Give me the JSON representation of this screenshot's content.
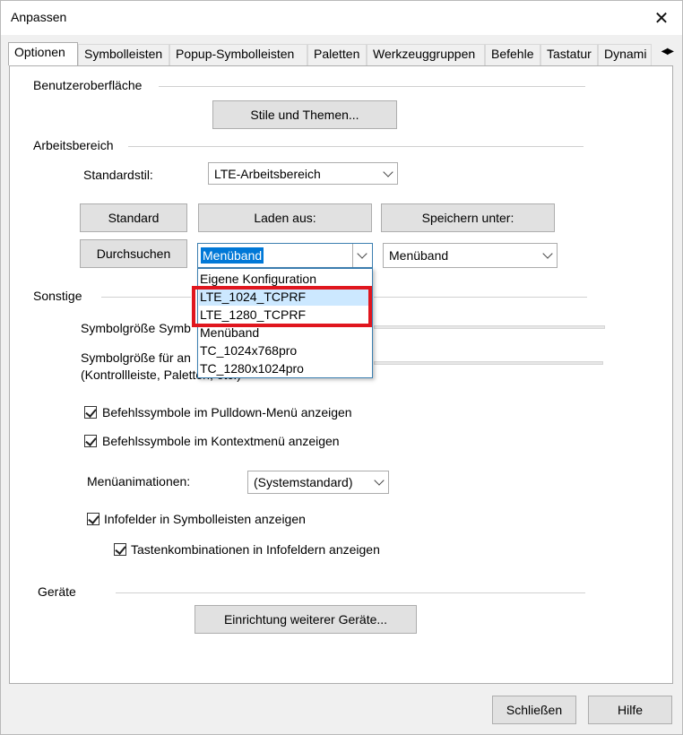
{
  "window": {
    "title": "Anpassen"
  },
  "tabs": [
    {
      "label": "Optionen"
    },
    {
      "label": "Symbolleisten"
    },
    {
      "label": "Popup-Symbolleisten"
    },
    {
      "label": "Paletten"
    },
    {
      "label": "Werkzeuggruppen"
    },
    {
      "label": "Befehle"
    },
    {
      "label": "Tastatur"
    },
    {
      "label": "Dynami"
    }
  ],
  "sections": {
    "ui": "Benutzeroberfläche",
    "workspace": "Arbeitsbereich",
    "misc": "Sonstige",
    "devices": "Geräte"
  },
  "buttons": {
    "styles": "Stile und Themen...",
    "standard": "Standard",
    "load_from": "Laden aus:",
    "save_as": "Speichern unter:",
    "browse": "Durchsuchen",
    "devices_setup": "Einrichtung weiterer Geräte...",
    "close": "Schließen",
    "help": "Hilfe"
  },
  "workspace": {
    "default_style_label": "Standardstil:",
    "default_style_value": "LTE-Arbeitsbereich",
    "load_combo_value": "Menüband",
    "save_combo_value": "Menüband",
    "dropdown_options": [
      "Eigene Konfiguration",
      "LTE_1024_TCPRF",
      "LTE_1280_TCPRF",
      "Menüband",
      "TC_1024x768pro",
      "TC_1280x1024pro"
    ]
  },
  "misc": {
    "icon_size_label": "Symbolgröße Symb",
    "icon_size_other_label_1": "Symbolgröße für an",
    "icon_size_other_label_2": "(Kontrollleiste, Paletten, etc.)",
    "cb_pulldown": "Befehlssymbole im Pulldown-Menü anzeigen",
    "cb_context": "Befehlssymbole im Kontextmenü anzeigen",
    "menu_anim_label": "Menüanimationen:",
    "menu_anim_value": "(Systemstandard)",
    "cb_infofields": "Infofelder in Symbolleisten anzeigen",
    "cb_shortcuts": "Tastenkombinationen in Infofeldern anzeigen"
  }
}
